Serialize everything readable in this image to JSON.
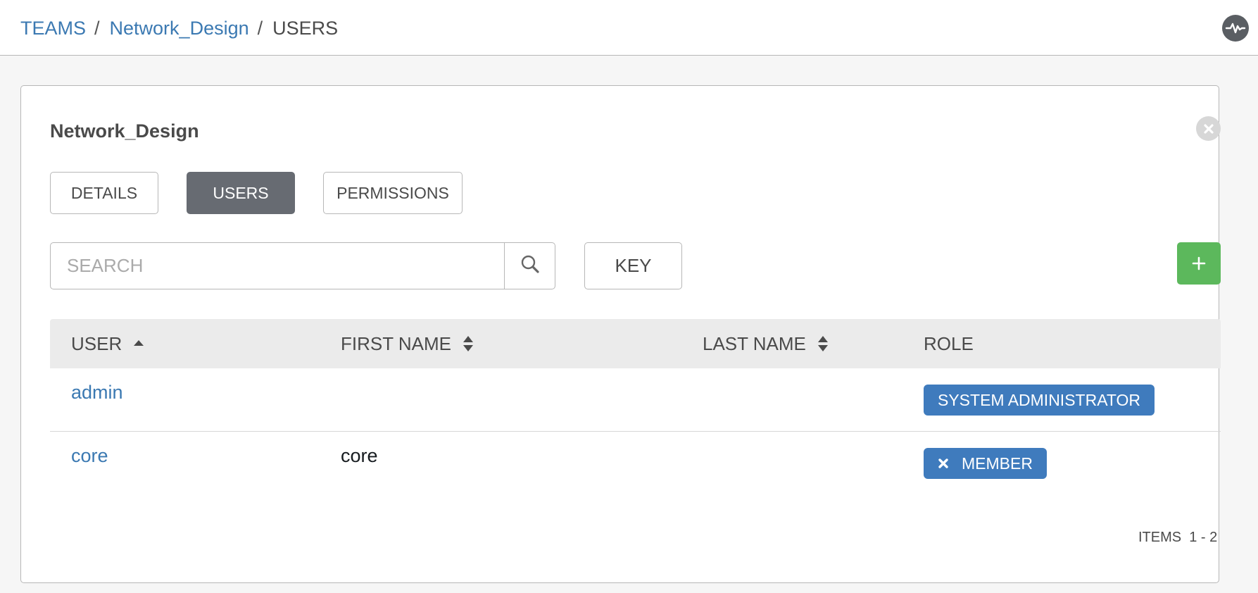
{
  "breadcrumb": {
    "teams": "TEAMS",
    "team": "Network_Design",
    "current": "USERS",
    "separator": "/"
  },
  "panel": {
    "title": "Network_Design"
  },
  "tabs": [
    {
      "label": "DETAILS",
      "active": false
    },
    {
      "label": "USERS",
      "active": true
    },
    {
      "label": "PERMISSIONS",
      "active": false
    }
  ],
  "search": {
    "placeholder": "SEARCH",
    "value": ""
  },
  "key_label": "KEY",
  "add_label": "+",
  "table": {
    "columns": [
      "USER",
      "FIRST NAME",
      "LAST NAME",
      "ROLE"
    ],
    "rows": [
      {
        "user": "admin",
        "first_name": "",
        "last_name": "",
        "role": "SYSTEM ADMINISTRATOR",
        "removable": false
      },
      {
        "user": "core",
        "first_name": "core",
        "last_name": "",
        "role": "MEMBER",
        "removable": true
      }
    ]
  },
  "pagination": {
    "label": "ITEMS",
    "range": "1 - 2"
  },
  "icons": {
    "activity": "activity-stream-icon",
    "close": "close-icon",
    "search": "search-icon",
    "sort_asc": "sort-ascending-icon",
    "sort": "sort-icon",
    "remove": "remove-x-icon"
  },
  "colors": {
    "link": "#3b79b2",
    "active_tab": "#676b72",
    "add_button": "#5cb85c",
    "role_badge": "#3f7bbd"
  }
}
